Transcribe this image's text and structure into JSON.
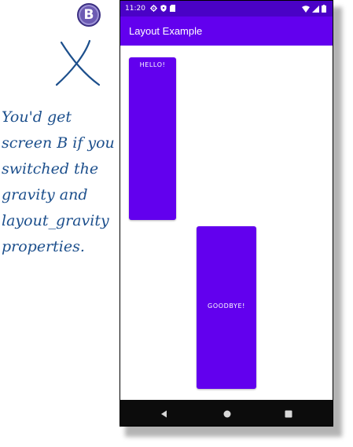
{
  "annotation": {
    "badge_letter": "B",
    "note_lines": [
      "You'd get",
      "screen B if you",
      "switched the",
      "gravity and",
      "layout_gravity",
      "properties."
    ],
    "colors": {
      "ink": "#1c4f8c",
      "badge": "#6c5bb3"
    }
  },
  "phone": {
    "status_bar": {
      "time": "11:20",
      "left_icons": [
        "gear-icon",
        "shield-icon",
        "sd-card-icon"
      ],
      "right_icons": [
        "wifi-icon",
        "signal-icon",
        "battery-icon"
      ]
    },
    "app_bar": {
      "title": "Layout Example"
    },
    "buttons": {
      "hello": "HELLO!",
      "goodbye": "GOODBYE!"
    },
    "nav_bar": [
      "back-icon",
      "home-icon",
      "recents-icon"
    ],
    "colors": {
      "primary": "#6200ee",
      "primary_dark": "#4a02c6"
    }
  }
}
